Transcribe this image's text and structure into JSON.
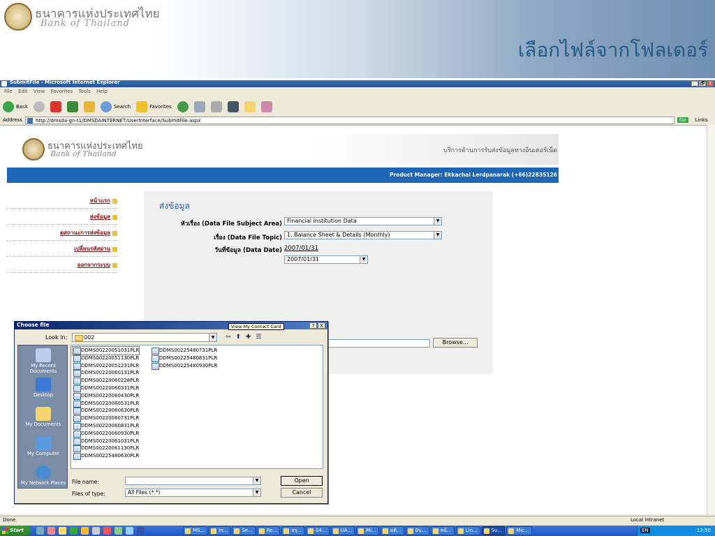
{
  "slide": {
    "brand_th": "ธนาคารแห่งประเทศไทย",
    "brand_en": "Bank of Thailand",
    "title": "เลือกไฟล์จากโฟลเดอร์"
  },
  "browser": {
    "window_title": "SubmitFile - Microsoft Internet Explorer",
    "window_controls": [
      "_",
      "🗗",
      "X"
    ],
    "menu": [
      "File",
      "Edit",
      "View",
      "Favorites",
      "Tools",
      "Help"
    ],
    "toolbar": {
      "back": "Back",
      "search": "Search",
      "favorites": "Favorites"
    },
    "address_label": "Address",
    "address": "http://dmsda-gn-t1/DMSDAINTERNET/UserInterface/SubmitFile.aspx",
    "go": "Go",
    "links": "Links",
    "status_left": "Done",
    "status_zone": "Local intranet"
  },
  "page": {
    "brand_th": "ธนาคารแห่งประเทศไทย",
    "brand_en": "Bank of Thailand",
    "service_title": "บริการด้านการรับส่งข้อมูลทางอินเตอร์เน็ต",
    "product_manager": "Product Manager: Ekkachai Lerdpanarak (+66)22835126",
    "nav": [
      "หน้าแรก",
      "ส่งข้อมูล",
      "ดูสถานะการส่งข้อมูล",
      "เปลี่ยนรหัสผ่าน",
      "ออกจากระบบ"
    ],
    "heading": "ส่งข้อมูล",
    "subject_label": "หัวเรื่อง (Data File Subject Area)",
    "subject_value": "Financial Institution Data",
    "topic_label": "เรื่อง (Data File Topic)",
    "topic_value": "1. Balance Sheet & Details (Monthly)",
    "date_label": "วันที่ข้อมูล (Data Date)",
    "date_link": "2007/01/31",
    "date_value": "2007/01/31",
    "browse": "Browse..."
  },
  "dialog": {
    "title": "Choose file",
    "tooltip": "View My Contact Card",
    "title_buttons": [
      "?",
      "X"
    ],
    "lookin_label": "Look in:",
    "lookin_value": "002",
    "places": [
      "My Recent Documents",
      "Desktop",
      "My Documents",
      "My Computer",
      "My Network Places"
    ],
    "files_col1": [
      "DDMS00220051031PLR",
      "DDMS00220051130PLR",
      "DDMS00220051231PLR",
      "DDMS00220060131PLR",
      "DDMS00220060228PLR",
      "DDMS00220060331PLR",
      "DDMS00220060430PLR",
      "DDMS00220060531PLR",
      "DDMS00220060630PLR",
      "DDMS00220060731PLR",
      "DDMS00220060831PLR",
      "DDMS00220060930PLR",
      "DDMS00220061031PLR",
      "DDMS00220061130PLR",
      "DDMS00225480630PLR"
    ],
    "files_col2": [
      "DDMS00225480731PLR",
      "DDMS00225480831PLR",
      "DDMS00225480930PLR"
    ],
    "filename_label": "File name:",
    "filename_value": "",
    "filetype_label": "Files of type:",
    "filetype_value": "All Files (*.*)",
    "open": "Open",
    "cancel": "Cancel"
  },
  "taskbar": {
    "start": "Start",
    "tasks": [
      "MS...",
      "In...",
      "Se...",
      "Re...",
      "สรุ...",
      "04...",
      "UA...",
      "Mi...",
      "มติ...",
      "Bu...",
      "หน้...",
      "Lin...",
      "Su...",
      "Mic..."
    ],
    "lang": "EN",
    "clock": "13:50"
  }
}
